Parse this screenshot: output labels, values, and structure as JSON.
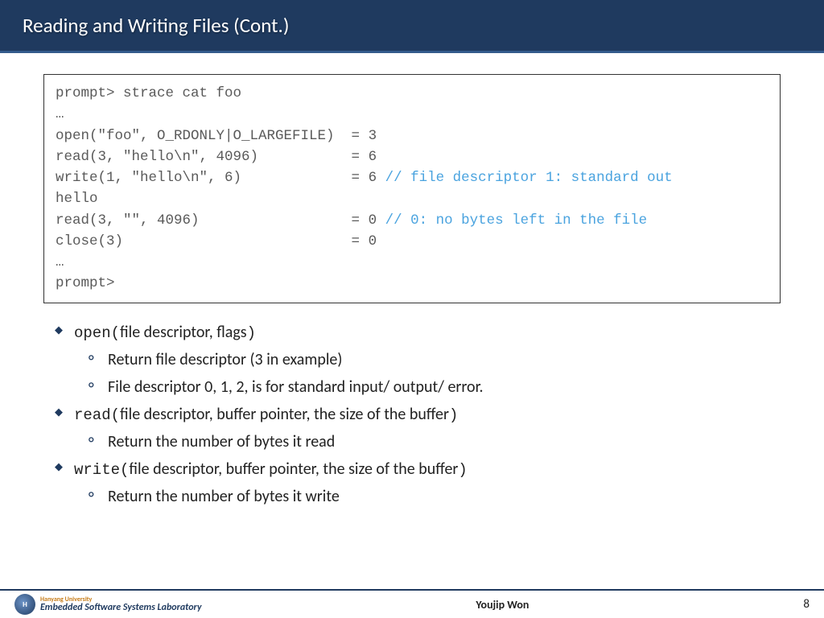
{
  "header": {
    "title": "Reading and Writing Files (Cont.)"
  },
  "code": {
    "l1": "prompt> strace cat foo",
    "l2": "…",
    "l3": "open(\"foo\", O_RDONLY|O_LARGEFILE)  = 3",
    "l4a": "read(3, \"hello\\n\", 4096)           = 6",
    "l5a": "write(1, \"hello\\n\", 6)             = 6 ",
    "l5b": "// file descriptor 1: standard out",
    "l6": "hello",
    "l7a": "read(3, \"\", 4096)                  = 0 ",
    "l7b": "// 0: no bytes left in the file",
    "l8": "close(3)                           = 0",
    "l9": "…",
    "l10": "prompt>"
  },
  "bul": {
    "a_code": "open(",
    "a_txt": "file descriptor, flags",
    "a_end": ")",
    "a1": "Return file descriptor (3 in example)",
    "a2": "File descriptor 0, 1, 2, is for standard input/ output/ error.",
    "b_code": "read(",
    "b_txt": "file descriptor, buffer pointer, the size of the buffer",
    "b_end": ")",
    "b1": "Return the number of bytes it read",
    "c_code": "write(",
    "c_txt": "file descriptor, buffer pointer, the size of the buffer",
    "c_end": ")",
    "c1": "Return the number of bytes it write"
  },
  "footer": {
    "uni": "Hanyang University",
    "lab": "Embedded Software Systems Laboratory",
    "author": "Youjip Won",
    "page": "8"
  }
}
